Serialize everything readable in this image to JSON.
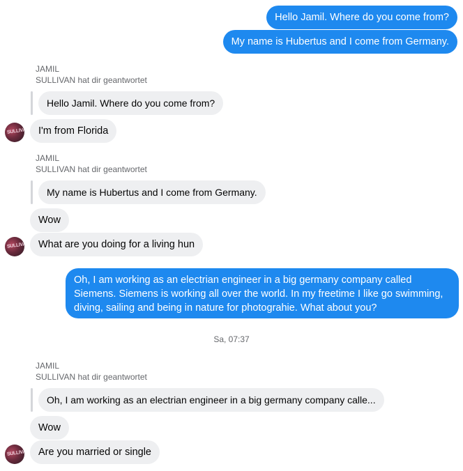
{
  "messages": {
    "out1": "Hello Jamil. Where do you come from?",
    "out2": "My name is Hubertus and I come from Germany.",
    "reply1_name": "JAMIL",
    "reply1_label": "SULLIVAN hat dir geantwortet",
    "reply1_quote": "Hello Jamil. Where do you come from?",
    "in1": "I'm from Florida",
    "reply2_name": "JAMIL",
    "reply2_label": "SULLIVAN hat dir geantwortet",
    "reply2_quote": "My name is Hubertus and I come from Germany.",
    "in2": "Wow",
    "in3": "What are you doing for a living hun",
    "out3": "Oh, I am working as an electrian engineer in a big germany company called Siemens. Siemens is working all over the world. In my freetime I like go swimming, diving, sailing and being in nature for photograhie. What about you?",
    "timestamp": "Sa, 07:37",
    "reply3_name": "JAMIL",
    "reply3_label": "SULLIVAN hat dir geantwortet",
    "reply3_quote": "Oh, I am working as an electrian engineer in a big germany company calle...",
    "in4": "Wow",
    "in5": "Are you married or single"
  },
  "contact": {
    "avatar_text": "SULLIVA"
  },
  "colors": {
    "outgoing_bubble": "#1e89ef",
    "incoming_bubble": "#eeeff1"
  }
}
